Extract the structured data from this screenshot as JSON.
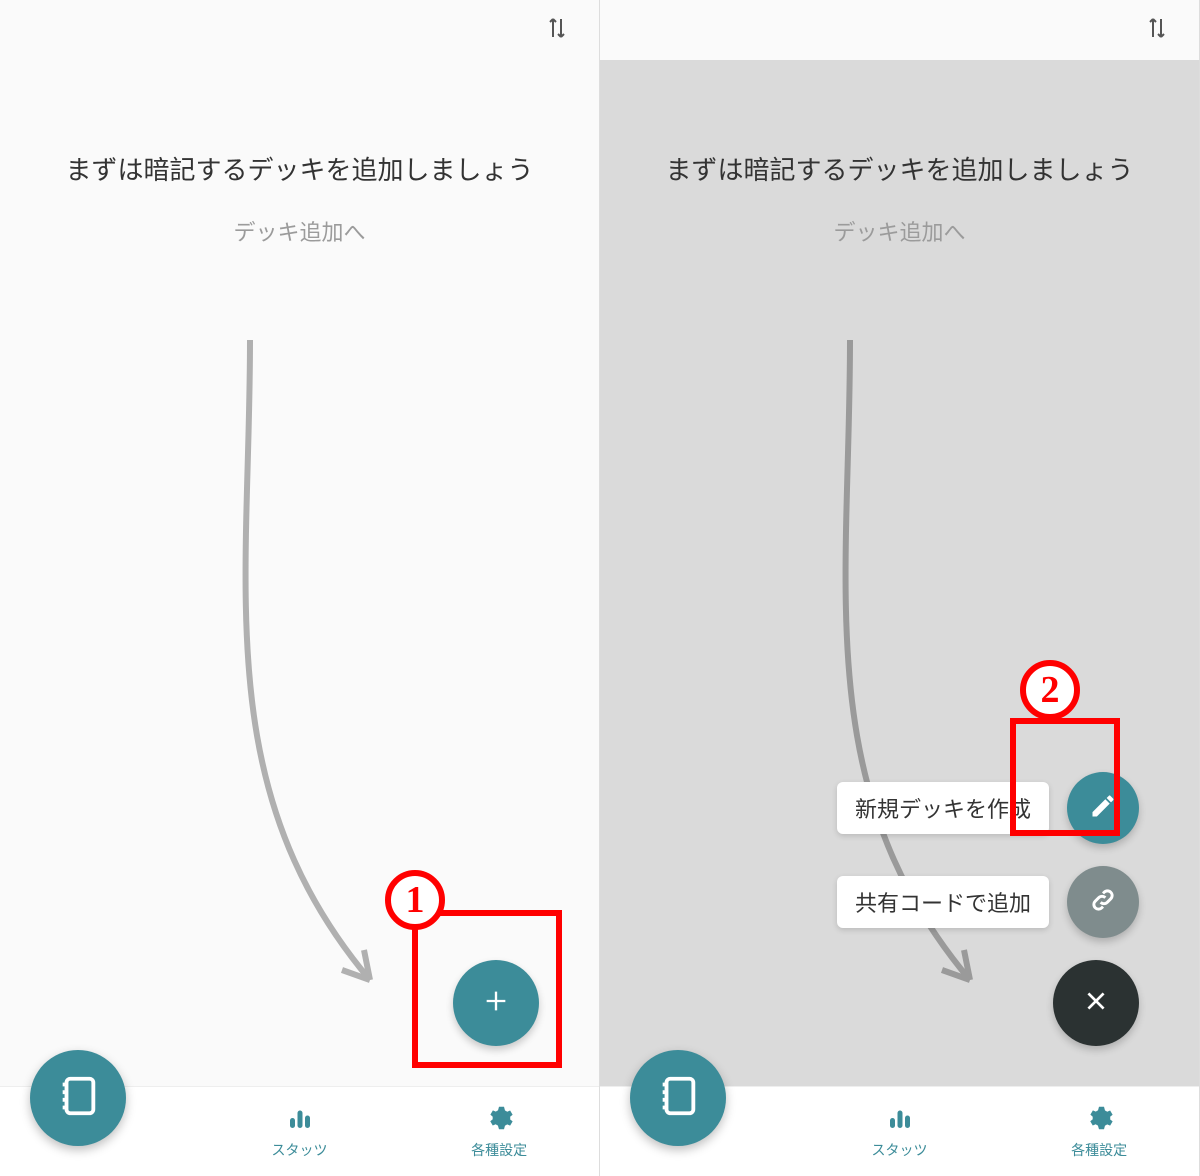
{
  "colors": {
    "accent": "#3c8c99",
    "annotation": "#ff0000",
    "muted": "#9b9b9b",
    "dial_gray": "#7f8c8d",
    "dial_dark": "#2b3232"
  },
  "icons": {
    "sort": "sort-icon",
    "plus": "plus-icon",
    "pencil": "pencil-icon",
    "link": "link-icon",
    "close": "close-icon",
    "notebook": "notebook-icon",
    "bars": "bars-icon",
    "gear": "gear-icon"
  },
  "empty_state": {
    "title": "まずは暗記するデッキを追加しましょう",
    "subtitle": "デッキ追加へ"
  },
  "speed_dial": {
    "create_label": "新規デッキを作成",
    "share_label": "共有コードで追加"
  },
  "bottom_nav": {
    "decks_label": "",
    "stats_label": "スタッツ",
    "settings_label": "各種設定"
  },
  "annotations": {
    "badge1": "1",
    "badge2": "2"
  }
}
